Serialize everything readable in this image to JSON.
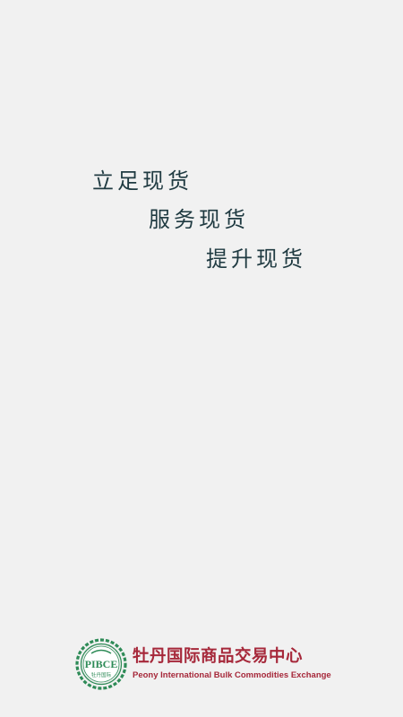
{
  "slogans": [
    "立足现货",
    "服务现货",
    "提升现货"
  ],
  "brand": {
    "logo_icon": "pibce-logo-icon",
    "logo_text": "PIBCE",
    "logo_sub": "牡丹国际",
    "name_cn": "牡丹国际商品交易中心",
    "name_en": "Peony International Bulk Commodities Exchange"
  },
  "colors": {
    "background": "#f1f1f1",
    "slogan": "#1f3a41",
    "brand_red": "#a6283a",
    "logo_green": "#2e8b57"
  }
}
